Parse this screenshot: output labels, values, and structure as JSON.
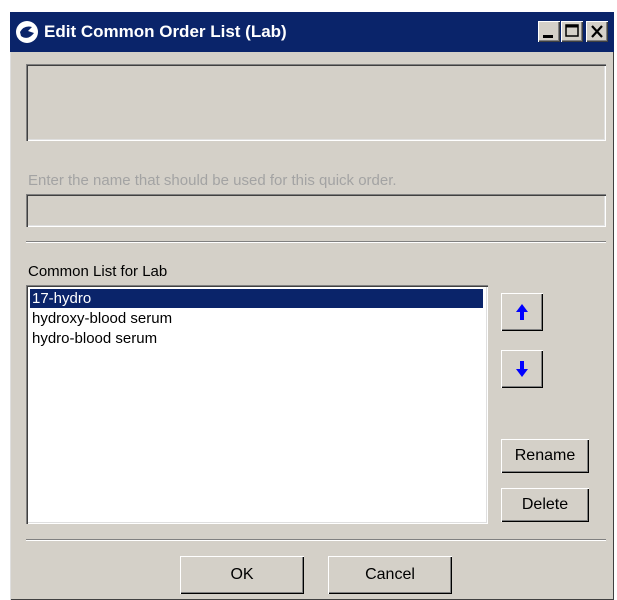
{
  "window": {
    "title": "Edit Common Order List (Lab)",
    "icons": {
      "app": "app-icon",
      "minimize": "minimize-icon",
      "maximize": "maximize-icon",
      "close": "close-icon"
    }
  },
  "quick_order": {
    "hint": "Enter the name that should be used for this quick order.",
    "value": ""
  },
  "common_list": {
    "label": "Common List for Lab",
    "items": [
      "17-hydro",
      "hydroxy-blood serum",
      "hydro-blood serum"
    ],
    "selected": "17-hydro"
  },
  "buttons": {
    "move_up_icon": "arrow-up-icon",
    "move_down_icon": "arrow-down-icon",
    "rename": "Rename",
    "delete": "Delete",
    "ok": "OK",
    "cancel": "Cancel"
  },
  "colors": {
    "titlebar": "#0a246a",
    "face": "#d4d0c8",
    "selection": "#0a246a",
    "arrow": "#0000ff"
  }
}
